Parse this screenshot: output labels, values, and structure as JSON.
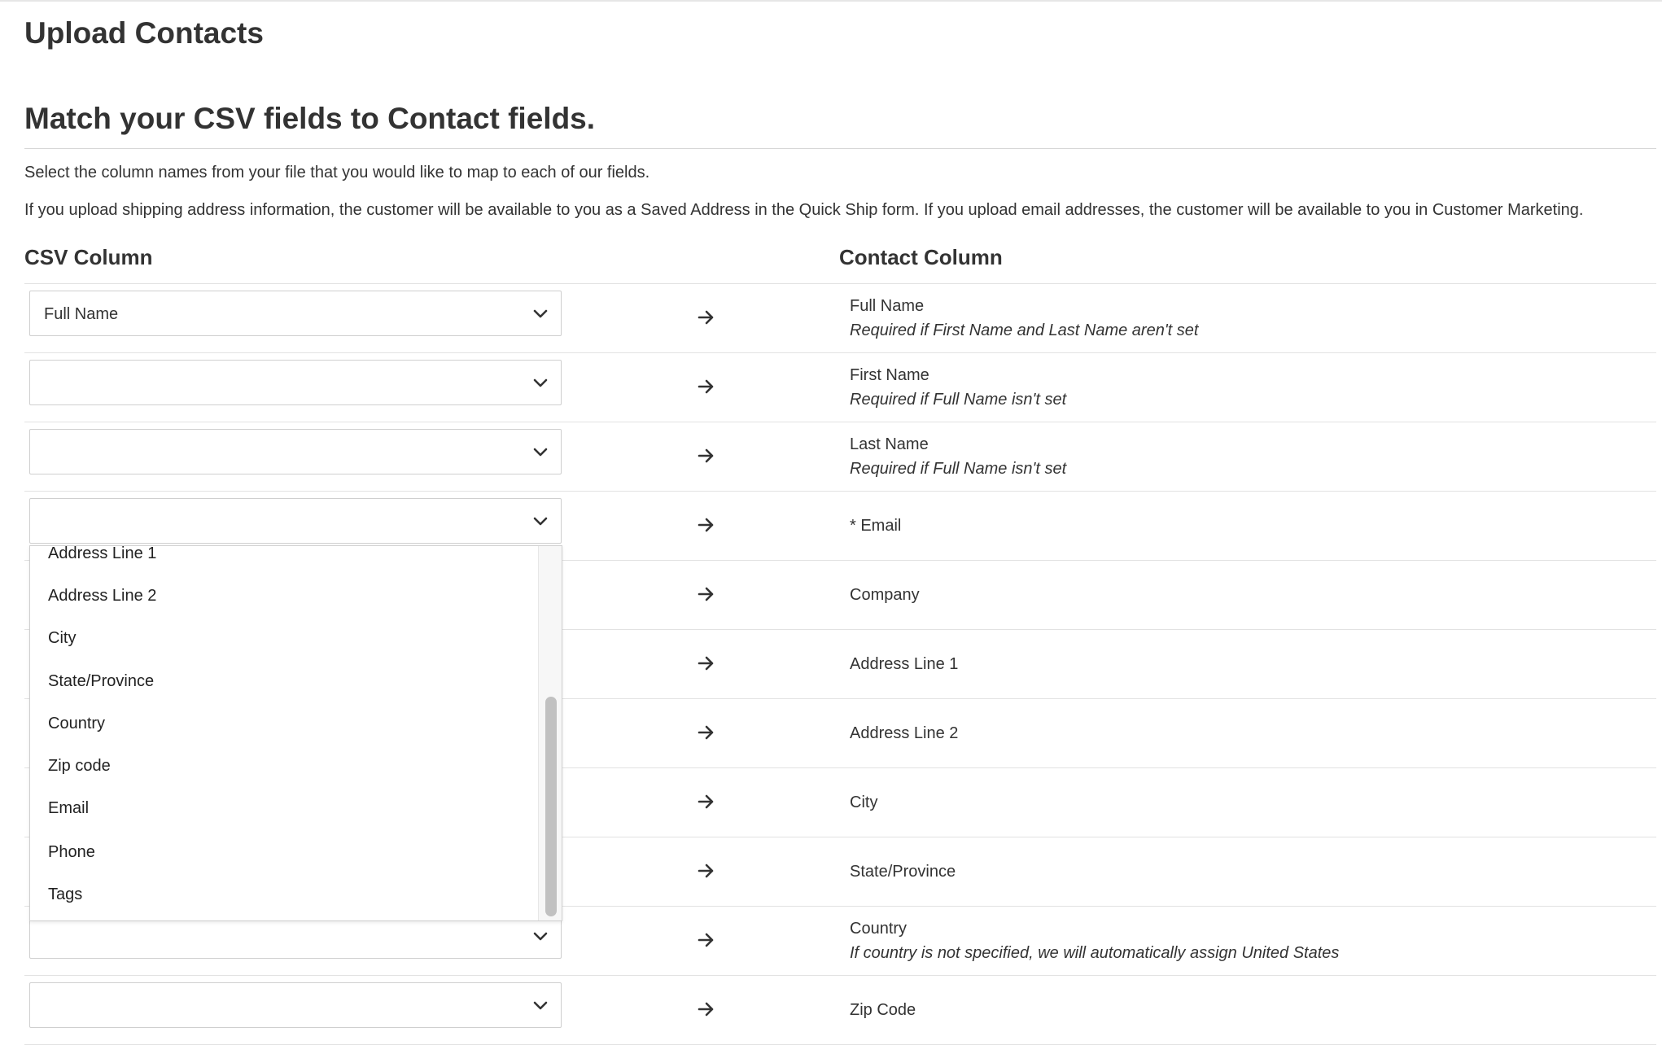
{
  "page": {
    "title": "Upload Contacts",
    "section_title": "Match your CSV fields to Contact fields.",
    "instruction": "Select the column names from your file that you would like to map to each of our fields.",
    "info": "If you upload shipping address information, the customer will be available to you as a Saved Address in the Quick Ship form. If you upload email addresses, the customer will be available to you in Customer Marketing."
  },
  "columns": {
    "csv": "CSV Column",
    "contact": "Contact Column"
  },
  "mappings": [
    {
      "csv_value": "Full Name",
      "field": "Full Name",
      "note": "Required if First Name and Last Name aren't set"
    },
    {
      "csv_value": "",
      "field": "First Name",
      "note": "Required if Full Name isn't set"
    },
    {
      "csv_value": "",
      "field": "Last Name",
      "note": "Required if Full Name isn't set"
    },
    {
      "csv_value": "",
      "field": "* Email",
      "note": ""
    },
    {
      "csv_value": "",
      "field": "Company",
      "note": ""
    },
    {
      "csv_value": "",
      "field": "Address Line 1",
      "note": ""
    },
    {
      "csv_value": "",
      "field": "Address Line 2",
      "note": ""
    },
    {
      "csv_value": "",
      "field": "City",
      "note": ""
    },
    {
      "csv_value": "",
      "field": "State/Province",
      "note": ""
    },
    {
      "csv_value": "",
      "field": "Country",
      "note": "If country is not specified, we will automatically assign United States"
    },
    {
      "csv_value": "",
      "field": "Zip Code",
      "note": ""
    }
  ],
  "dropdown": {
    "options": [
      "Address Line 1",
      "Address Line 2",
      "City",
      "State/Province",
      "Country",
      "Zip code",
      "Email",
      "Phone",
      "Tags"
    ]
  },
  "icons": {
    "select_chevron": "chevron-down-icon",
    "mapping_arrow": "arrow-right-icon"
  },
  "colors": {
    "text": "#333333",
    "border": "#cfcfcf",
    "divider": "#e2e2e2"
  }
}
